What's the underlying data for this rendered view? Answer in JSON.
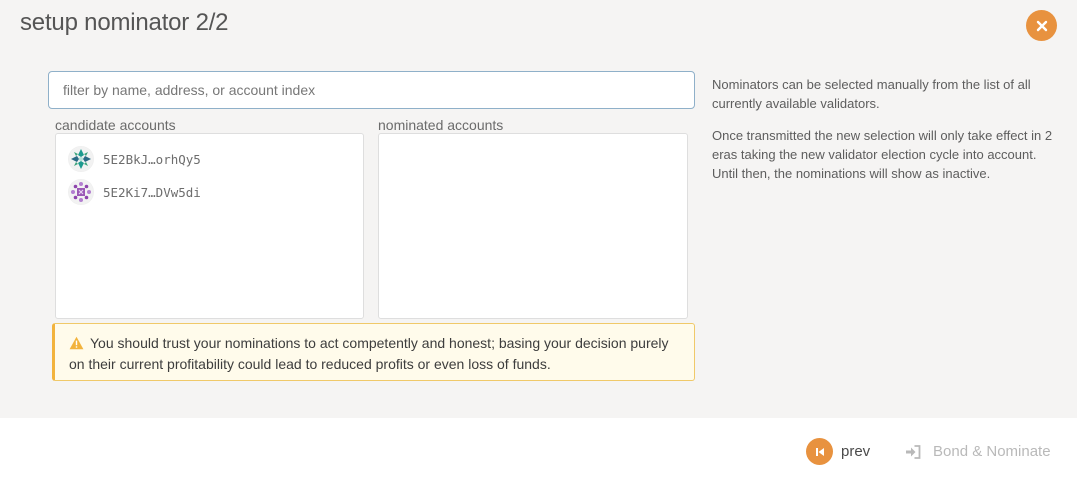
{
  "modal": {
    "title": "setup nominator 2/2",
    "close_icon": "close-icon"
  },
  "search": {
    "placeholder": "filter by name, address, or account index",
    "value": ""
  },
  "candidates": {
    "label": "candidate accounts",
    "items": [
      {
        "address": "5E2BkJ…orhQy5",
        "icon": "identicon"
      },
      {
        "address": "5E2Ki7…DVw5di",
        "icon": "identicon"
      }
    ]
  },
  "nominated": {
    "label": "nominated accounts",
    "items": []
  },
  "warning": {
    "icon": "warning-icon",
    "text": "You should trust your nominations to act competently and honest; basing your decision purely on their current profitability could lead to reduced profits or even loss of funds."
  },
  "info": {
    "p1": "Nominators can be selected manually from the list of all currently available validators.",
    "p2": "Once transmitted the new selection will only take effect in 2 eras taking the new validator election cycle into account. Until then, the nominations will show as inactive."
  },
  "footer": {
    "prev_label": "prev",
    "bond_label": "Bond & Nominate"
  },
  "colors": {
    "accent": "#e8923f",
    "warning_border": "#f2b33d",
    "input_border": "#8fb0c9"
  }
}
